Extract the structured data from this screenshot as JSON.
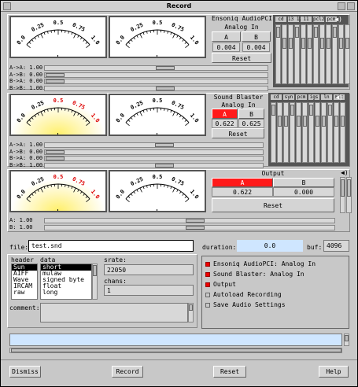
{
  "window": {
    "title": "Record"
  },
  "meter": {
    "ticks": [
      "0.0",
      "0.25",
      "0.5",
      "0.75",
      "1.0"
    ]
  },
  "card1": {
    "name": "Ensoniq AudioPCI",
    "sub": "Analog In",
    "a": "A",
    "b": "B",
    "val_a": "0.004",
    "val_b": "0.004",
    "reset": "Reset",
    "gain": {
      "a": 0.004,
      "b": 0.004
    },
    "mixer_cols": [
      "cd",
      "13 12",
      "11",
      "pcl2",
      "pcm",
      "",
      "",
      "",
      "",
      ""
    ],
    "sliders": [
      {
        "label": "A->A: 1.00",
        "level": 1.0
      },
      {
        "label": "A->B: 0.00",
        "level": 0
      },
      {
        "label": "B->A: 0.00",
        "level": 0
      },
      {
        "label": "B->B: 1.00",
        "level": 1.0
      }
    ]
  },
  "card2": {
    "name": "Sound Blaster",
    "sub": "Analog In",
    "a": "A",
    "b": "B",
    "val_a": "0.622",
    "val_b": "0.625",
    "reset": "Reset",
    "mixer_cols": [
      "cd",
      "syn",
      "pcm",
      "igs",
      "ln",
      "mic"
    ],
    "sliders": [
      {
        "label": "A->A: 1.00",
        "level": 1.0
      },
      {
        "label": "A->B: 0.00",
        "level": 0
      },
      {
        "label": "B->A: 0.00",
        "level": 0
      },
      {
        "label": "B->B: 1.00",
        "level": 1.0
      }
    ]
  },
  "output": {
    "title": "Output",
    "a": "A",
    "b": "B",
    "val_a": "0.622",
    "val_b": "0.000",
    "reset": "Reset",
    "sliders": [
      {
        "label": "A: 1.00",
        "level": 1.0
      },
      {
        "label": "B: 1.00",
        "level": 1.0
      }
    ]
  },
  "file": {
    "label": "file:",
    "value": "test.snd"
  },
  "duration": {
    "label": "duration:",
    "value": "0.0"
  },
  "buf": {
    "label": "buf:",
    "value": "4096"
  },
  "header": {
    "label": "header",
    "items": [
      "Sun",
      "AIFF",
      "Wave",
      "IRCAM",
      "raw"
    ],
    "selected": "Sun"
  },
  "data": {
    "label": "data",
    "items": [
      "short",
      "mulaw",
      "signed byte",
      "float",
      "long"
    ],
    "selected": "short"
  },
  "srate": {
    "label": "srate:",
    "value": "22050"
  },
  "chans": {
    "label": "chans:",
    "value": "1"
  },
  "comment": {
    "label": "comment:",
    "value": ""
  },
  "options": [
    {
      "label": "Ensoniq AudioPCI: Analog In",
      "on": true
    },
    {
      "label": "Sound Blaster: Analog In",
      "on": true
    },
    {
      "label": "Output",
      "on": true
    },
    {
      "label": "Autoload Recording",
      "on": false
    },
    {
      "label": "Save Audio Settings",
      "on": false
    }
  ],
  "buttons": {
    "dismiss": "Dismiss",
    "record": "Record",
    "reset": "Reset",
    "help": "Help"
  },
  "colors": {
    "accent_red": "#ff1a1a",
    "active_blue": "#cfe6ff",
    "meter_glow": "#fff06a"
  }
}
